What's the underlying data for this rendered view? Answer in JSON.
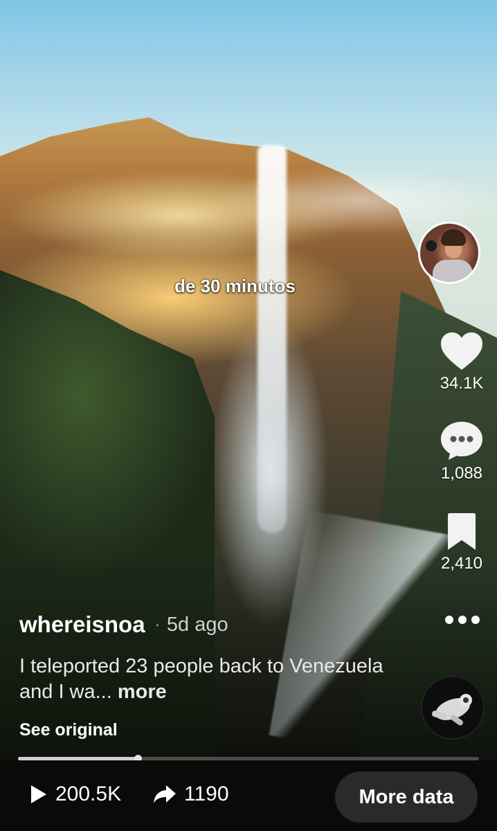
{
  "video": {
    "caption": "de 30 minutos"
  },
  "actions": {
    "likes": "34.1K",
    "comments": "1,088",
    "saves": "2,410"
  },
  "post": {
    "author": "whereisnoa",
    "separator": "·",
    "time_ago": "5d ago",
    "description": "I teleported 23 people back to Venezuela and I wa...",
    "more_label": "more",
    "see_original": "See original"
  },
  "progress": {
    "fraction": 0.26
  },
  "stats": {
    "views": "200.5K",
    "shares": "1190",
    "more_data_label": "More data"
  },
  "icons": {
    "like": "heart-icon",
    "comment": "comment-bubble-icon",
    "save": "bookmark-icon",
    "options": "more-horizontal-icon",
    "views": "play-icon",
    "shares": "share-arrow-icon"
  },
  "colors": {
    "bottom_bar": "#0a0a0a",
    "button_bg": "#2a2a2a",
    "text_primary": "#ffffff"
  }
}
